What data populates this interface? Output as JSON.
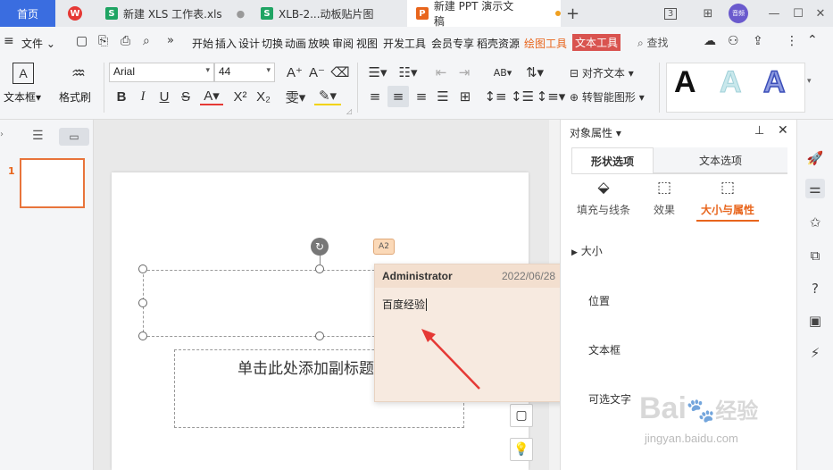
{
  "tabs": {
    "home": "首页",
    "xls": "新建 XLS 工作表.xls",
    "xlb": "XLB-2...动板贴片图",
    "ppt": "新建 PPT 演示文稿",
    "xls_badge": "S",
    "xlb_badge": "S",
    "ppt_badge": "P",
    "red_logo": "W"
  },
  "window": {
    "layout": "3",
    "avatar_text": "音频"
  },
  "menu": {
    "file": "文件",
    "items": [
      "开始",
      "插入",
      "设计",
      "切换",
      "动画",
      "放映",
      "审阅",
      "视图",
      "开发工具",
      "会员专享",
      "稻壳资源"
    ],
    "drawing_tools": "绘图工具",
    "text_tools": "文本工具",
    "search": "查找"
  },
  "ribbon": {
    "textbox": "文本框",
    "format_painter": "格式刷",
    "font_name": "Arial",
    "font_size": "44",
    "align_text": "对齐文本",
    "smart_shape": "转智能图形",
    "big_a": "A"
  },
  "left_panel": {
    "slide_number": "1"
  },
  "slide": {
    "subtitle_placeholder": "单击此处添加副标题",
    "comment_marker": "A2"
  },
  "comment": {
    "author": "Administrator",
    "date": "2022/06/28",
    "text": "百度经验"
  },
  "right_panel": {
    "title": "对象属性",
    "tab_shape": "形状选项",
    "tab_text": "文本选项",
    "sub_fill": "填充与线条",
    "sub_effect": "效果",
    "sub_size": "大小与属性",
    "sections": [
      "大小",
      "位置",
      "文本框",
      "可选文字"
    ]
  },
  "watermark": {
    "brand": "Bai",
    "brand2": "经验",
    "url": "jingyan.baidu.com"
  },
  "colors": {
    "accent": "#3a6de0",
    "orange": "#e8651c",
    "text_tool": "#d9534f",
    "comment_bg": "#f7eae0"
  }
}
